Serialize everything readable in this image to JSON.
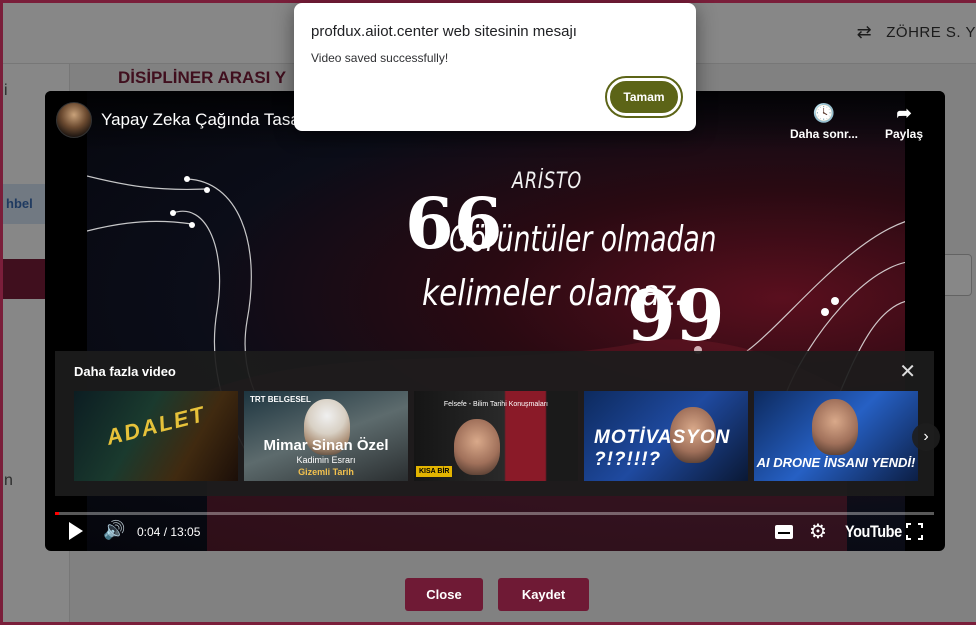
{
  "background_page": {
    "user_name": "ZÖHRE S. Y",
    "section_heading": "DİSİPLİNER ARASI Y",
    "sidebar_pill": "hbel",
    "sidebar_char_1": "i",
    "sidebar_char_2": "n"
  },
  "player": {
    "video_title": "Yapay Zeka Çağında Tasarı",
    "watch_later_label": "Daha sonr...",
    "share_label": "Paylaş",
    "quote": {
      "author": "ARİSTO",
      "open_mark": "66",
      "line1": "Görüntüler olmadan",
      "line2": "kelimeler olamaz.",
      "close_mark": "99"
    },
    "more_videos": {
      "title": "Daha fazla video",
      "close_icon": "close-icon",
      "thumbnails": [
        {
          "caption": "ADALET"
        },
        {
          "tag": "TRT BELGESEL",
          "caption": "Mimar Sinan Özel",
          "sub": "Kadimin Esrarı",
          "sub2": "Gizemli Tarih"
        },
        {
          "caption": "Felsefe - Bilim Tarihi Konuşmaları",
          "badge": "KISA BİR"
        },
        {
          "caption": "MOTİVASYON ?!?!!!?"
        },
        {
          "caption": "AI DRONE İNSANI YENDİ!"
        }
      ]
    },
    "progress_percent": 0.5,
    "time_display": "0:04 / 13:05",
    "logo_text": "YouTube"
  },
  "modal_buttons": {
    "close_label": "Close",
    "save_label": "Kaydet"
  },
  "alert": {
    "title": "profdux.aiiot.center web sitesinin mesajı",
    "message": "Video saved successfully!",
    "ok_label": "Tamam"
  },
  "colors": {
    "brand_maroon": "#6f1a35",
    "ok_button": "#5c6417",
    "progress_red": "#ff0000"
  }
}
